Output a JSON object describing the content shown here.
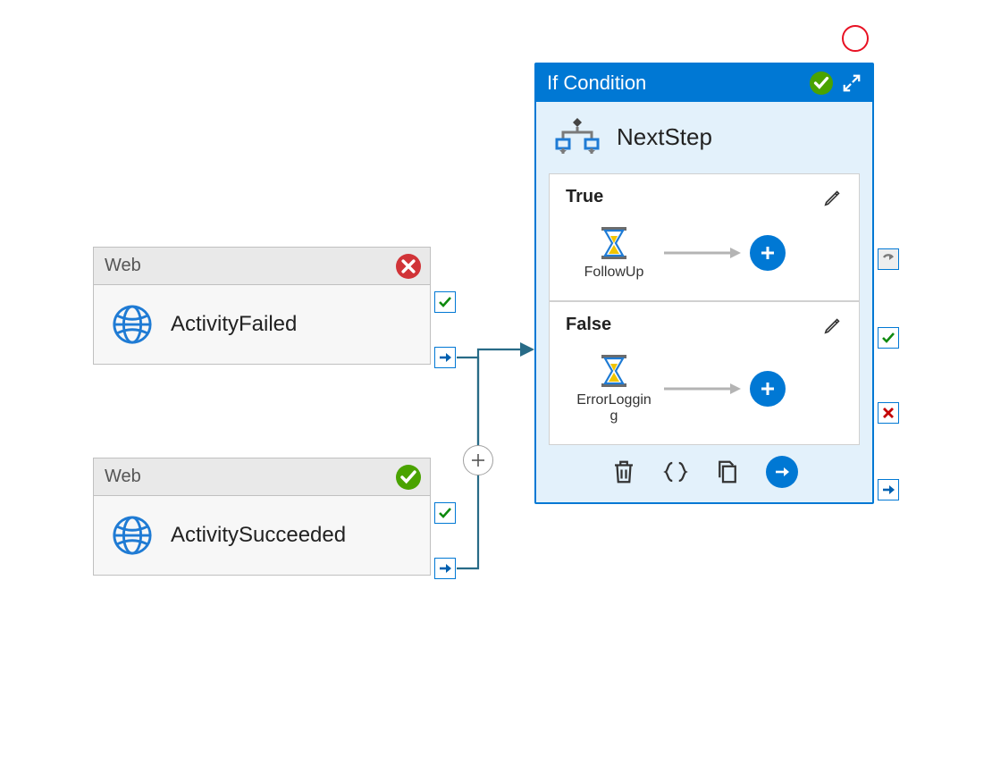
{
  "activities": [
    {
      "type_label": "Web",
      "name": "ActivityFailed",
      "status": "error"
    },
    {
      "type_label": "Web",
      "name": "ActivitySucceeded",
      "status": "success"
    }
  ],
  "ifCondition": {
    "header": "If Condition",
    "name": "NextStep",
    "branches": {
      "true": {
        "label": "True",
        "activity_name": "FollowUp"
      },
      "false": {
        "label": "False",
        "activity_name": "ErrorLogging"
      }
    }
  },
  "colors": {
    "primary": "#0078d4",
    "success": "#4aa300",
    "error": "#d13438"
  }
}
